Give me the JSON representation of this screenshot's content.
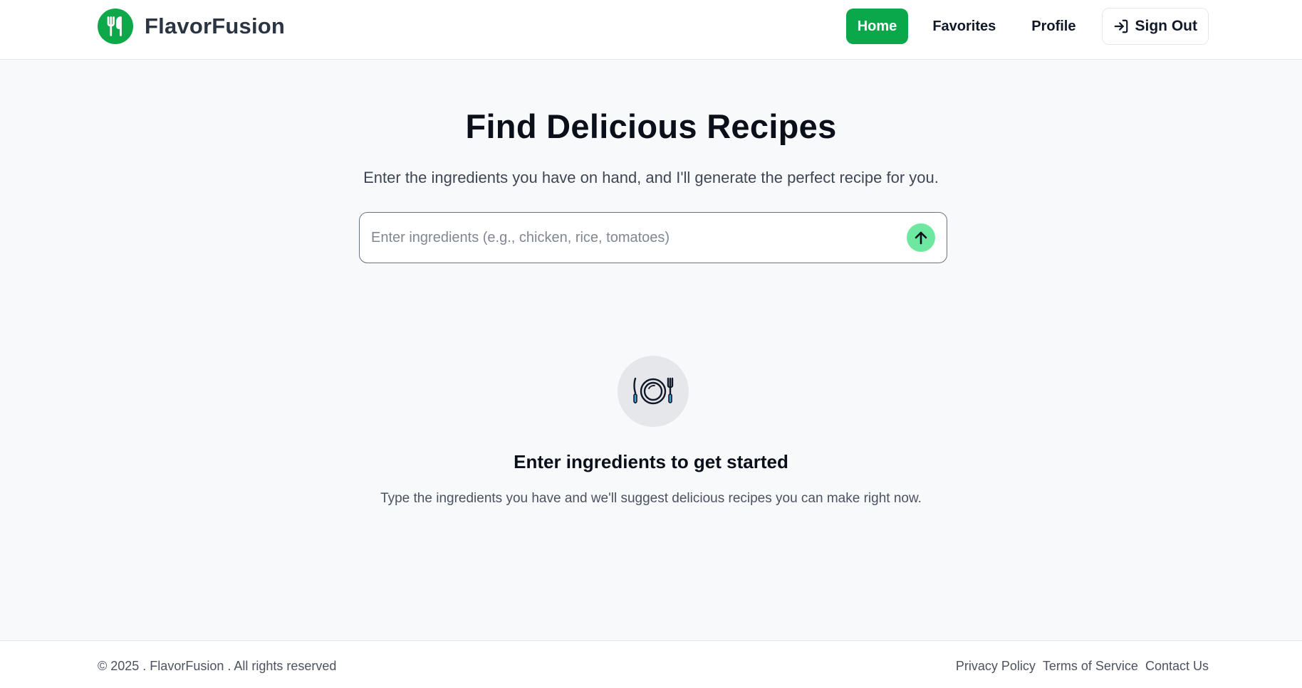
{
  "app": {
    "name": "FlavorFusion",
    "logo_icon": "utensils-icon",
    "accent_color": "#0aa84a"
  },
  "nav": {
    "items": [
      {
        "label": "Home",
        "active": true
      },
      {
        "label": "Favorites",
        "active": false
      },
      {
        "label": "Profile",
        "active": false
      }
    ],
    "signout_label": "Sign Out",
    "signout_icon": "sign-in-arrow-icon"
  },
  "hero": {
    "title": "Find Delicious Recipes",
    "subtitle": "Enter the ingredients you have on hand, and I'll generate the perfect recipe for you."
  },
  "search": {
    "placeholder": "Enter ingredients (e.g., chicken, rice, tomatoes)",
    "value": "",
    "submit_icon": "arrow-up-icon"
  },
  "empty_state": {
    "icon": "plate-cutlery-icon",
    "title": "Enter ingredients to get started",
    "description": "Type the ingredients you have and we'll suggest delicious recipes you can make right now."
  },
  "footer": {
    "copyright": "© 2025 . FlavorFusion . All rights reserved",
    "links": [
      "Privacy Policy",
      "Terms of Service",
      "Contact Us"
    ]
  }
}
